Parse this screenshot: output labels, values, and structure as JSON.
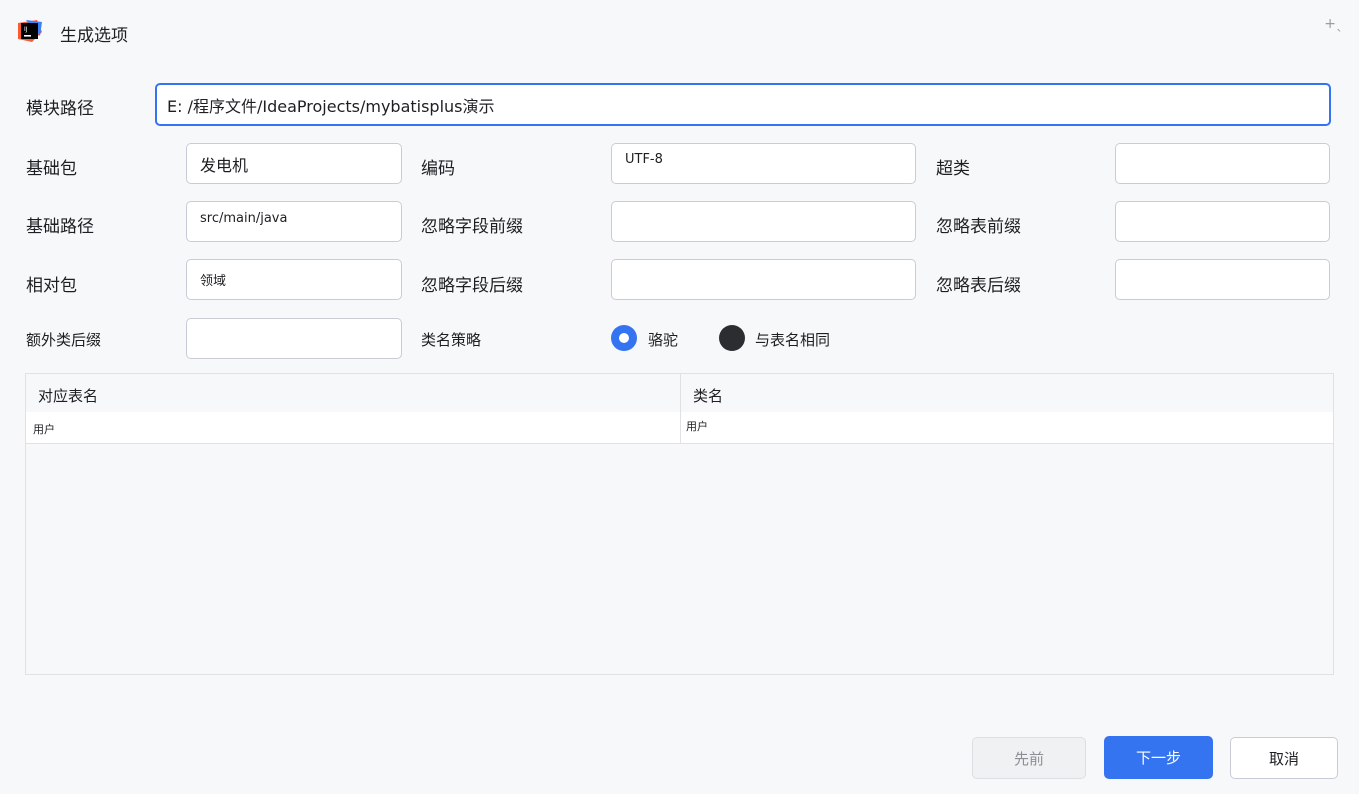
{
  "window": {
    "title": "生成选项"
  },
  "form": {
    "module_path": {
      "label": "模块路径",
      "value": "E:  /程序文件/IdeaProjects/mybatisplus演示"
    },
    "base_package": {
      "label": "基础包",
      "value": "发电机"
    },
    "encoding": {
      "label": "编码",
      "value": "UTF-8"
    },
    "superclass": {
      "label": "超类",
      "value": ""
    },
    "base_path": {
      "label": "基础路径",
      "value": "src/main/java"
    },
    "ignore_field_prefix": {
      "label": "忽略字段前缀",
      "value": ""
    },
    "ignore_table_prefix": {
      "label": "忽略表前缀",
      "value": ""
    },
    "relative_package": {
      "label": "相对包",
      "value": "领域"
    },
    "ignore_field_suffix": {
      "label": "忽略字段后缀",
      "value": ""
    },
    "ignore_table_suffix": {
      "label": "忽略表后缀",
      "value": ""
    },
    "extra_class_suffix": {
      "label": "额外类后缀",
      "value": ""
    },
    "class_name_strategy": {
      "label": "类名策略",
      "options": [
        "骆驼",
        "与表名相同"
      ],
      "selected": "骆驼"
    }
  },
  "table": {
    "columns": [
      "对应表名",
      "类名"
    ],
    "rows": [
      [
        "用户",
        "用户"
      ]
    ]
  },
  "buttons": {
    "previous": "先前",
    "next": "下一步",
    "cancel": "取消"
  },
  "colors": {
    "accent": "#3574f0",
    "background": "#f7f8fa"
  }
}
